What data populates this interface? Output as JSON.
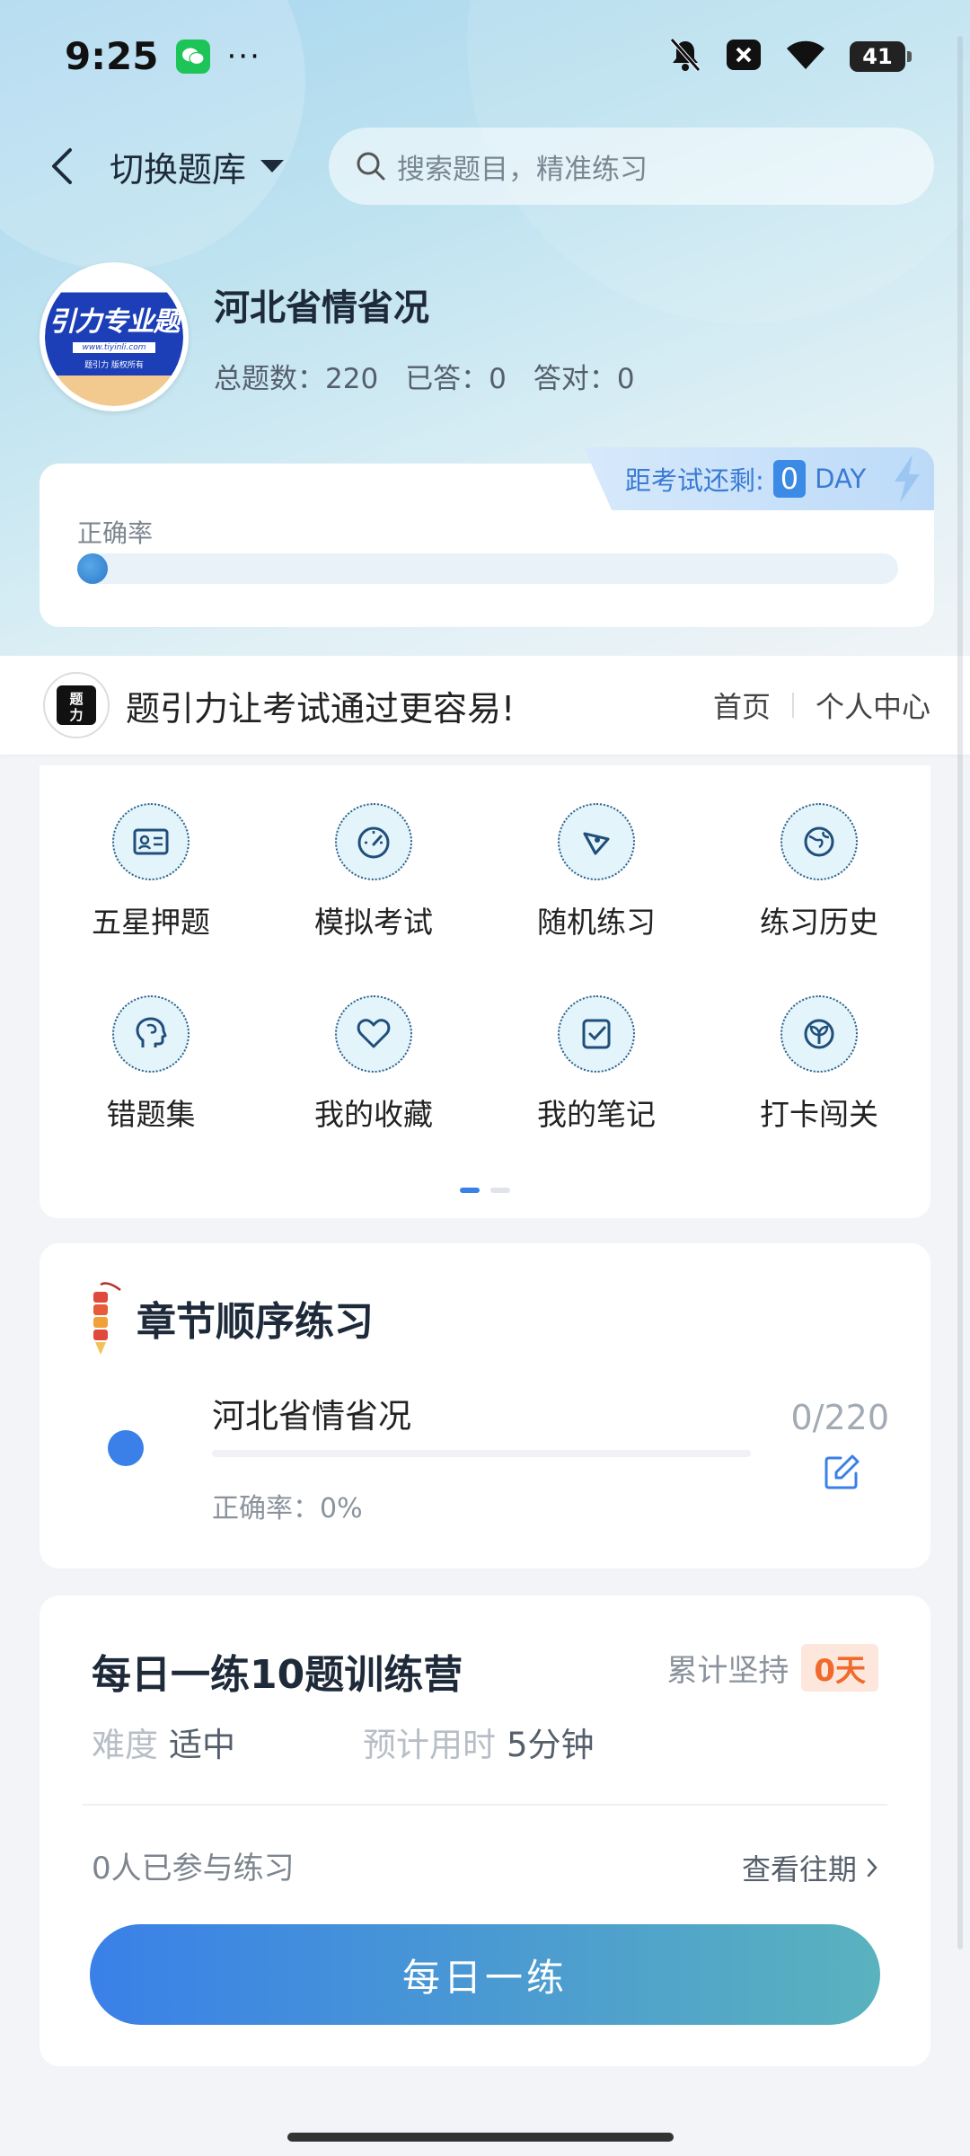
{
  "status_bar": {
    "time": "9:25",
    "battery": "41"
  },
  "nav": {
    "switch_label": "切换题库",
    "search_placeholder": "搜索题目，精准练习"
  },
  "bank": {
    "title": "河北省情省况",
    "logo_text": "引力专业题",
    "logo_url": "www.tiyinli.com",
    "logo_sub": "题引力 版权所有",
    "stats": [
      {
        "label": "总题数：",
        "value": "220"
      },
      {
        "label": "已答：",
        "value": "0"
      },
      {
        "label": "答对：",
        "value": "0"
      }
    ]
  },
  "countdown": {
    "label": "距考试还剩:",
    "value": "0",
    "unit": "DAY"
  },
  "accuracy": {
    "label": "正确率",
    "value_percent": 0
  },
  "promo": {
    "logo_text": "题引力",
    "text": "题引力让考试通过更容易!",
    "links": [
      "首页",
      "个人中心"
    ]
  },
  "features": [
    {
      "label": "五星押题",
      "icon": "id-card-icon"
    },
    {
      "label": "模拟考试",
      "icon": "speedometer-icon"
    },
    {
      "label": "随机练习",
      "icon": "shuffle-icon"
    },
    {
      "label": "练习历史",
      "icon": "globe-icon"
    },
    {
      "label": "错题集",
      "icon": "brain-head-icon"
    },
    {
      "label": "我的收藏",
      "icon": "heart-icon"
    },
    {
      "label": "我的笔记",
      "icon": "notebook-check-icon"
    },
    {
      "label": "打卡闯关",
      "icon": "sprout-icon"
    }
  ],
  "chapter": {
    "title": "章节顺序练习",
    "name": "河北省情省况",
    "accuracy": "正确率：0%",
    "count": "0/220"
  },
  "daily": {
    "title": "每日一练10题训练营",
    "streak_label": "累计坚持",
    "streak_value": "0天",
    "difficulty_label": "难度",
    "difficulty_value": "适中",
    "time_label": "预计用时",
    "time_value": "5分钟",
    "participants": "0人已参与练习",
    "history_link": "查看往期",
    "button": "每日一练"
  },
  "colors": {
    "accent": "#3a80e8",
    "streak": "#f06a2c"
  }
}
